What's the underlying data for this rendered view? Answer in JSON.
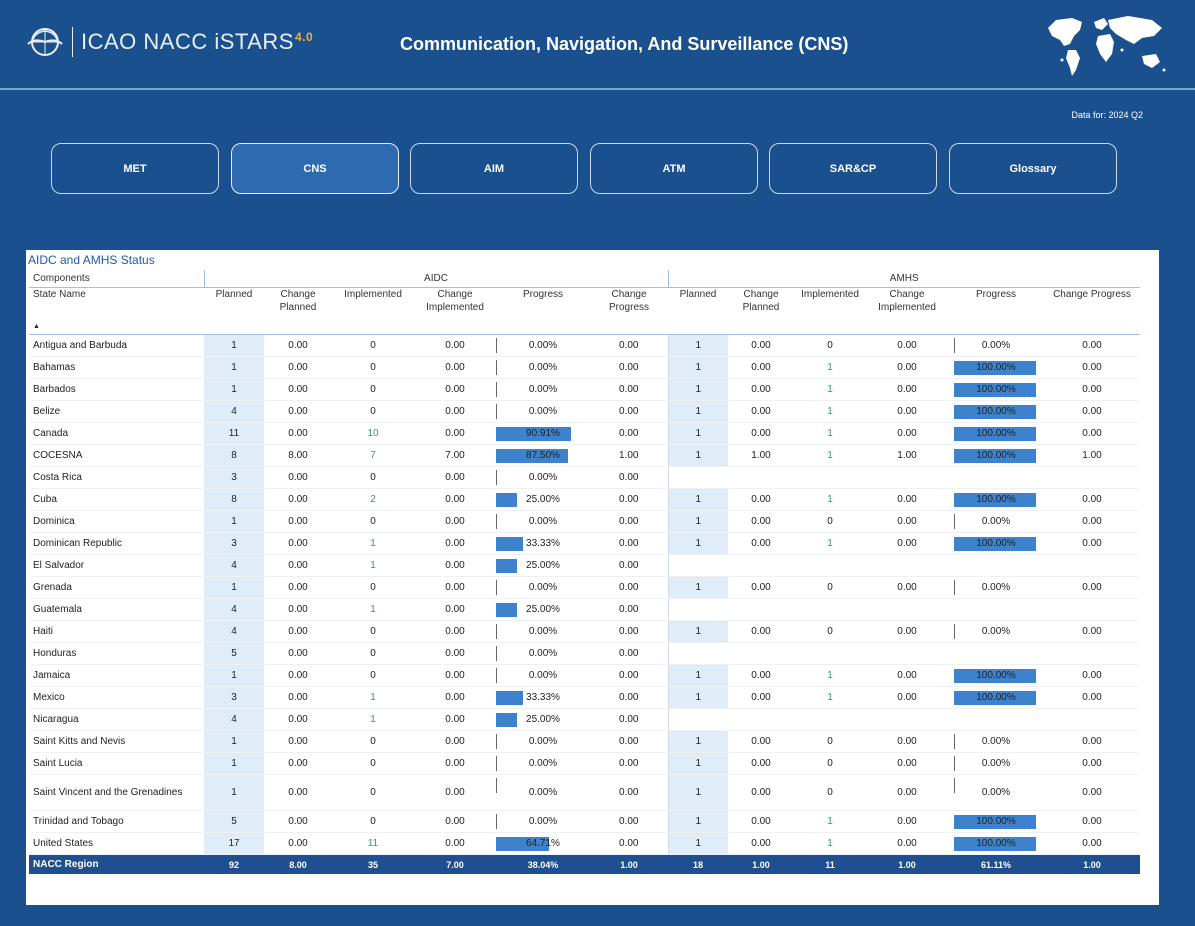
{
  "header": {
    "brand": "ICAO NACC iSTARS",
    "brand_version": "4.0",
    "title": "Communication, Navigation, And Surveillance (CNS)",
    "data_for": "Data for: 2024 Q2"
  },
  "nav": [
    {
      "label": "MET",
      "active": false
    },
    {
      "label": "CNS",
      "active": true
    },
    {
      "label": "AIM",
      "active": false
    },
    {
      "label": "ATM",
      "active": false
    },
    {
      "label": "SAR&CP",
      "active": false
    },
    {
      "label": "Glossary",
      "active": false
    }
  ],
  "panel": {
    "title": "AIDC and AMHS Status",
    "components_label": "Components",
    "group_aidc": "AIDC",
    "group_amhs": "AMHS",
    "col_state": "State Name",
    "columns": [
      "Planned",
      "Change Planned",
      "Implemented",
      "Change Implemented",
      "Progress",
      "Change Progress"
    ]
  },
  "rows": [
    {
      "state": "Antigua and Barbuda",
      "aidc": [
        "1",
        "0.00",
        "0",
        "0.00",
        "0.00%",
        "0.00"
      ],
      "aidc_pct": 0,
      "amhs": [
        "1",
        "0.00",
        "0",
        "0.00",
        "0.00%",
        "0.00"
      ],
      "amhs_pct": 0
    },
    {
      "state": "Bahamas",
      "aidc": [
        "1",
        "0.00",
        "0",
        "0.00",
        "0.00%",
        "0.00"
      ],
      "aidc_pct": 0,
      "amhs": [
        "1",
        "0.00",
        "1",
        "0.00",
        "100.00%",
        "0.00"
      ],
      "amhs_pct": 100
    },
    {
      "state": "Barbados",
      "aidc": [
        "1",
        "0.00",
        "0",
        "0.00",
        "0.00%",
        "0.00"
      ],
      "aidc_pct": 0,
      "amhs": [
        "1",
        "0.00",
        "1",
        "0.00",
        "100.00%",
        "0.00"
      ],
      "amhs_pct": 100
    },
    {
      "state": "Belize",
      "aidc": [
        "4",
        "0.00",
        "0",
        "0.00",
        "0.00%",
        "0.00"
      ],
      "aidc_pct": 0,
      "amhs": [
        "1",
        "0.00",
        "1",
        "0.00",
        "100.00%",
        "0.00"
      ],
      "amhs_pct": 100
    },
    {
      "state": "Canada",
      "aidc": [
        "11",
        "0.00",
        "10",
        "0.00",
        "90.91%",
        "0.00"
      ],
      "aidc_pct": 90.91,
      "amhs": [
        "1",
        "0.00",
        "1",
        "0.00",
        "100.00%",
        "0.00"
      ],
      "amhs_pct": 100
    },
    {
      "state": "COCESNA",
      "aidc": [
        "8",
        "8.00",
        "7",
        "7.00",
        "87.50%",
        "1.00"
      ],
      "aidc_pct": 87.5,
      "amhs": [
        "1",
        "1.00",
        "1",
        "1.00",
        "100.00%",
        "1.00"
      ],
      "amhs_pct": 100
    },
    {
      "state": "Costa Rica",
      "aidc": [
        "3",
        "0.00",
        "0",
        "0.00",
        "0.00%",
        "0.00"
      ],
      "aidc_pct": 0,
      "amhs": null
    },
    {
      "state": "Cuba",
      "aidc": [
        "8",
        "0.00",
        "2",
        "0.00",
        "25.00%",
        "0.00"
      ],
      "aidc_pct": 25,
      "amhs": [
        "1",
        "0.00",
        "1",
        "0.00",
        "100.00%",
        "0.00"
      ],
      "amhs_pct": 100
    },
    {
      "state": "Dominica",
      "aidc": [
        "1",
        "0.00",
        "0",
        "0.00",
        "0.00%",
        "0.00"
      ],
      "aidc_pct": 0,
      "amhs": [
        "1",
        "0.00",
        "0",
        "0.00",
        "0.00%",
        "0.00"
      ],
      "amhs_pct": 0
    },
    {
      "state": "Dominican Republic",
      "aidc": [
        "3",
        "0.00",
        "1",
        "0.00",
        "33.33%",
        "0.00"
      ],
      "aidc_pct": 33.33,
      "amhs": [
        "1",
        "0.00",
        "1",
        "0.00",
        "100.00%",
        "0.00"
      ],
      "amhs_pct": 100
    },
    {
      "state": "El Salvador",
      "aidc": [
        "4",
        "0.00",
        "1",
        "0.00",
        "25.00%",
        "0.00"
      ],
      "aidc_pct": 25,
      "amhs": null
    },
    {
      "state": "Grenada",
      "aidc": [
        "1",
        "0.00",
        "0",
        "0.00",
        "0.00%",
        "0.00"
      ],
      "aidc_pct": 0,
      "amhs": [
        "1",
        "0.00",
        "0",
        "0.00",
        "0.00%",
        "0.00"
      ],
      "amhs_pct": 0
    },
    {
      "state": "Guatemala",
      "aidc": [
        "4",
        "0.00",
        "1",
        "0.00",
        "25.00%",
        "0.00"
      ],
      "aidc_pct": 25,
      "amhs": null
    },
    {
      "state": "Haiti",
      "aidc": [
        "4",
        "0.00",
        "0",
        "0.00",
        "0.00%",
        "0.00"
      ],
      "aidc_pct": 0,
      "amhs": [
        "1",
        "0.00",
        "0",
        "0.00",
        "0.00%",
        "0.00"
      ],
      "amhs_pct": 0
    },
    {
      "state": "Honduras",
      "aidc": [
        "5",
        "0.00",
        "0",
        "0.00",
        "0.00%",
        "0.00"
      ],
      "aidc_pct": 0,
      "amhs": null
    },
    {
      "state": "Jamaica",
      "aidc": [
        "1",
        "0.00",
        "0",
        "0.00",
        "0.00%",
        "0.00"
      ],
      "aidc_pct": 0,
      "amhs": [
        "1",
        "0.00",
        "1",
        "0.00",
        "100.00%",
        "0.00"
      ],
      "amhs_pct": 100
    },
    {
      "state": "Mexico",
      "aidc": [
        "3",
        "0.00",
        "1",
        "0.00",
        "33.33%",
        "0.00"
      ],
      "aidc_pct": 33.33,
      "amhs": [
        "1",
        "0.00",
        "1",
        "0.00",
        "100.00%",
        "0.00"
      ],
      "amhs_pct": 100
    },
    {
      "state": "Nicaragua",
      "aidc": [
        "4",
        "0.00",
        "1",
        "0.00",
        "25.00%",
        "0.00"
      ],
      "aidc_pct": 25,
      "amhs": null
    },
    {
      "state": "Saint Kitts and Nevis",
      "aidc": [
        "1",
        "0.00",
        "0",
        "0.00",
        "0.00%",
        "0.00"
      ],
      "aidc_pct": 0,
      "amhs": [
        "1",
        "0.00",
        "0",
        "0.00",
        "0.00%",
        "0.00"
      ],
      "amhs_pct": 0
    },
    {
      "state": "Saint Lucia",
      "aidc": [
        "1",
        "0.00",
        "0",
        "0.00",
        "0.00%",
        "0.00"
      ],
      "aidc_pct": 0,
      "amhs": [
        "1",
        "0.00",
        "0",
        "0.00",
        "0.00%",
        "0.00"
      ],
      "amhs_pct": 0
    },
    {
      "state": "Saint Vincent and the Grenadines",
      "aidc": [
        "1",
        "0.00",
        "0",
        "0.00",
        "0.00%",
        "0.00"
      ],
      "aidc_pct": 0,
      "amhs": [
        "1",
        "0.00",
        "0",
        "0.00",
        "0.00%",
        "0.00"
      ],
      "amhs_pct": 0,
      "tall": true
    },
    {
      "state": "Trinidad and Tobago",
      "aidc": [
        "5",
        "0.00",
        "0",
        "0.00",
        "0.00%",
        "0.00"
      ],
      "aidc_pct": 0,
      "amhs": [
        "1",
        "0.00",
        "1",
        "0.00",
        "100.00%",
        "0.00"
      ],
      "amhs_pct": 100
    },
    {
      "state": "United States",
      "aidc": [
        "17",
        "0.00",
        "11",
        "0.00",
        "64.71%",
        "0.00"
      ],
      "aidc_pct": 64.71,
      "amhs": [
        "1",
        "0.00",
        "1",
        "0.00",
        "100.00%",
        "0.00"
      ],
      "amhs_pct": 100
    }
  ],
  "total": {
    "state": "NACC Region",
    "aidc": [
      "92",
      "8.00",
      "35",
      "7.00",
      "38.04%",
      "1.00"
    ],
    "amhs": [
      "18",
      "1.00",
      "11",
      "1.00",
      "61.11%",
      "1.00"
    ]
  },
  "colors": {
    "background": "#1a508d",
    "active_tab": "#2d6ab0",
    "progress_bar": "#3d82cc",
    "total_row": "#1f4f8e",
    "implemented_green": "#2e9e5a"
  }
}
